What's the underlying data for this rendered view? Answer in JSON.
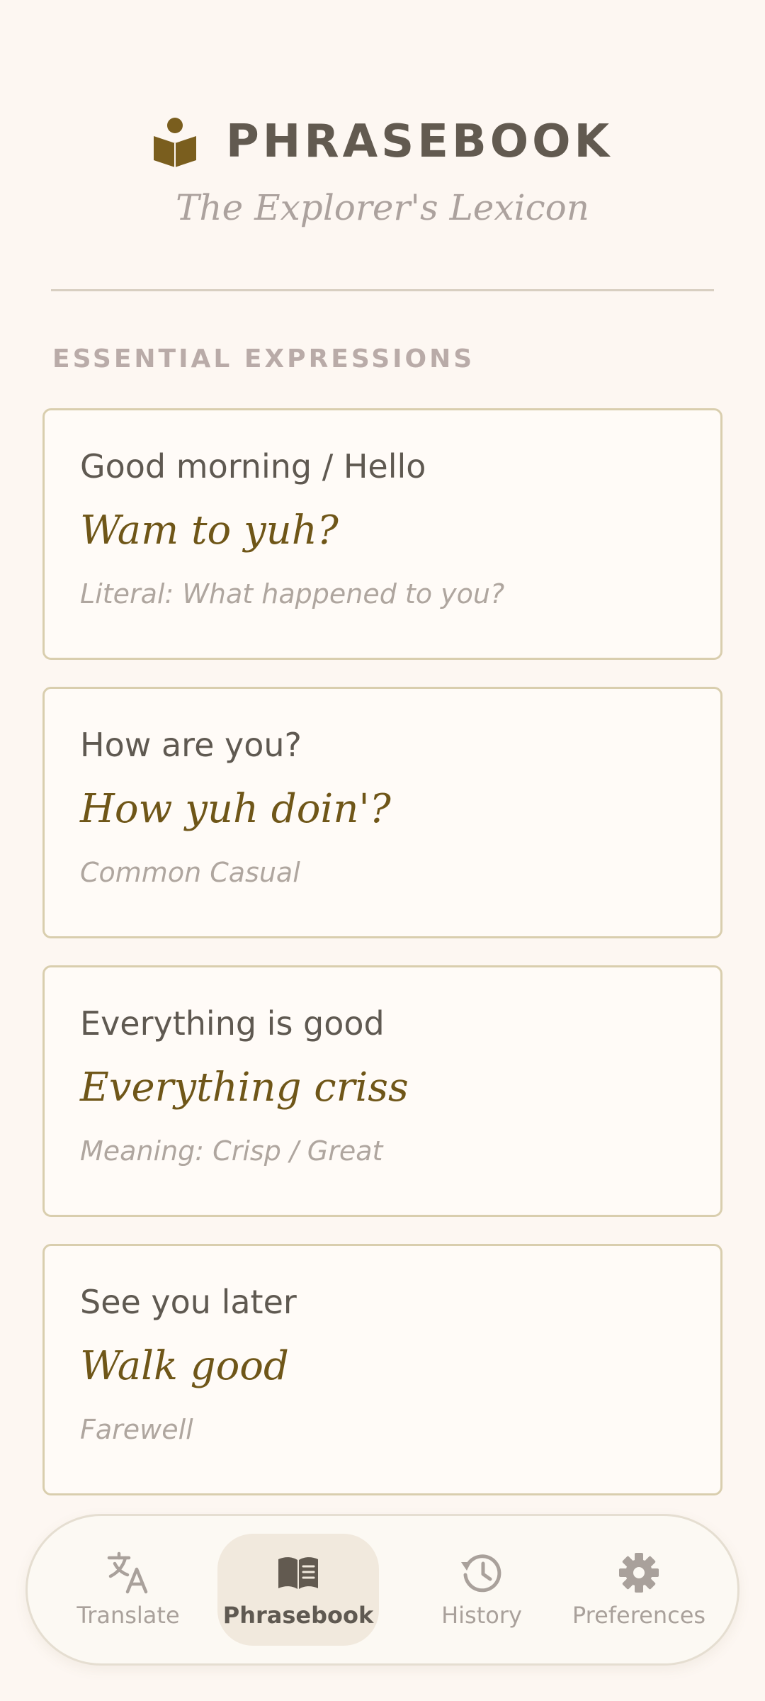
{
  "header": {
    "logo_icon": "book-reader-icon",
    "title": "PHRASEBOOK",
    "subtitle": "The Explorer's Lexicon"
  },
  "section": {
    "label": "ESSENTIAL EXPRESSIONS"
  },
  "phrases": [
    {
      "english": "Good morning / Hello",
      "phrase": "Wam to yuh?",
      "note": "Literal: What happened to you?"
    },
    {
      "english": "How are you?",
      "phrase": "How yuh doin'?",
      "note": "Common Casual"
    },
    {
      "english": "Everything is good",
      "phrase": "Everything criss",
      "note": "Meaning: Crisp / Great"
    },
    {
      "english": "See you later",
      "phrase": "Walk good",
      "note": "Farewell"
    }
  ],
  "nav": {
    "items": [
      {
        "label": "Translate",
        "icon": "translate-icon",
        "active": false
      },
      {
        "label": "Phrasebook",
        "icon": "book-icon",
        "active": true
      },
      {
        "label": "History",
        "icon": "history-icon",
        "active": false
      },
      {
        "label": "Preferences",
        "icon": "gear-icon",
        "active": false
      }
    ]
  },
  "colors": {
    "background": "#FDF7F2",
    "accent": "#6F5618",
    "text_primary": "#5F5951",
    "text_muted": "#AFA69F",
    "card_border": "#D9CEAE",
    "nav_active_bg": "#F1E9DD"
  }
}
